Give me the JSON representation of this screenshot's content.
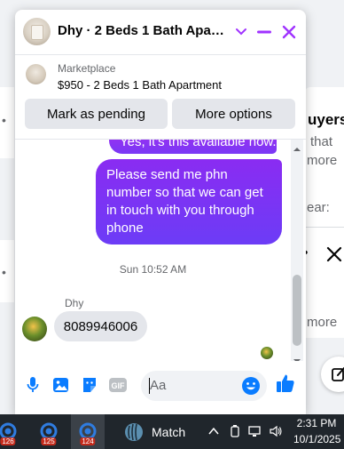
{
  "chat": {
    "title": "Dhy · 2 Beds 1 Bath Apart...",
    "listing": {
      "label": "Marketplace",
      "price_title": "$950 - 2 Beds 1 Bath Apartment",
      "mark_pending_label": "Mark as pending",
      "more_options_label": "More options"
    },
    "messages": {
      "outgoing_partial": "Yes, it's this available now.",
      "outgoing_main": "Please send me  phn number so that we can get in touch with you through phone",
      "timestamp": "Sun 10:52 AM",
      "sender_name": "Dhy",
      "incoming": "8089946006"
    },
    "composer": {
      "placeholder": "Aa"
    }
  },
  "background": {
    "heading_fragment": "uyers",
    "line1_fragment": "that",
    "line2_fragment": "more",
    "line3_fragment": "ear:",
    "line4_fragment": "more"
  },
  "taskbar": {
    "apps": [
      {
        "badge": "126"
      },
      {
        "badge": "125"
      },
      {
        "badge": "124"
      }
    ],
    "match_label": "Match",
    "time": "2:31 PM",
    "date": "10/1/2025"
  },
  "colors": {
    "accent": "#a033ff",
    "bubble_gradient_top": "#8a2cf2",
    "bubble_gradient_bottom": "#6c3cf6",
    "like_blue": "#0a7cff",
    "taskbar_bg": "#20262c"
  },
  "icons": {
    "header": [
      "chevron-down-icon",
      "minimize-icon",
      "close-icon"
    ],
    "composer": [
      "microphone-icon",
      "photo-icon",
      "sticker-icon",
      "gif-icon",
      "emoji-icon",
      "thumbs-up-icon"
    ]
  }
}
